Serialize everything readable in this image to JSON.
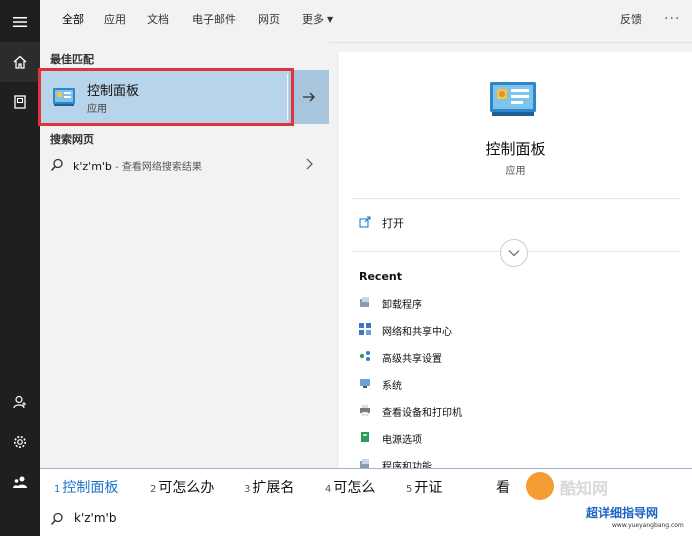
{
  "tabs": [
    {
      "label": "全部",
      "active": true
    },
    {
      "label": "应用"
    },
    {
      "label": "文档"
    },
    {
      "label": "电子邮件"
    },
    {
      "label": "网页"
    },
    {
      "label": "更多"
    }
  ],
  "feedback_label": "反馈",
  "more_options": "···",
  "best_match": {
    "section_label": "最佳匹配",
    "title": "控制面板",
    "subtitle": "应用"
  },
  "web_search": {
    "section_label": "搜索网页",
    "query": "k'z'm'b",
    "hint": " - 查看网络搜索结果"
  },
  "preview": {
    "title": "控制面板",
    "subtitle": "应用",
    "open_label": "打开",
    "recent_label": "Recent",
    "recent_items": [
      {
        "label": "卸载程序",
        "icon": "uninstall-icon"
      },
      {
        "label": "网络和共享中心",
        "icon": "network-icon"
      },
      {
        "label": "高级共享设置",
        "icon": "sharing-icon"
      },
      {
        "label": "系统",
        "icon": "system-icon"
      },
      {
        "label": "查看设备和打印机",
        "icon": "printer-icon"
      },
      {
        "label": "电源选项",
        "icon": "power-icon"
      },
      {
        "label": "程序和功能",
        "icon": "programs-icon"
      }
    ]
  },
  "ime": {
    "candidates": [
      {
        "num": "1",
        "text": "控制面板"
      },
      {
        "num": "2",
        "text": "可怎么办"
      },
      {
        "num": "3",
        "text": "扩展名"
      },
      {
        "num": "4",
        "text": "可怎么"
      },
      {
        "num": "5",
        "text": "开证"
      },
      {
        "num": "",
        "text": "看"
      }
    ]
  },
  "search_box": {
    "text": "k'z'm'b"
  },
  "watermark": {
    "text": "酷知网",
    "site": "超详细指导网",
    "url": "www.yueyangbang.com"
  },
  "colors": {
    "accent": "#0078d7",
    "selection": "#b7d4ea",
    "highlight_box": "#e0333a",
    "rail": "#1f1f1f"
  }
}
